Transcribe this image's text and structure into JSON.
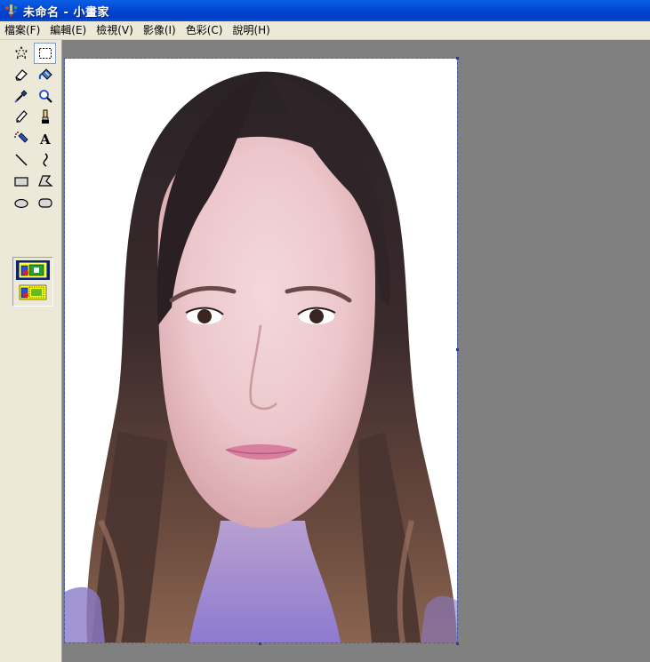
{
  "window": {
    "title": "未命名 - 小畫家"
  },
  "menu": [
    {
      "label": "檔案(F)"
    },
    {
      "label": "編輯(E)"
    },
    {
      "label": "檢視(V)"
    },
    {
      "label": "影像(I)"
    },
    {
      "label": "色彩(C)"
    },
    {
      "label": "說明(H)"
    }
  ],
  "tools": [
    {
      "name": "free-form-select",
      "icon": "free-form-select-icon"
    },
    {
      "name": "rectangle-select",
      "icon": "rectangle-select-icon",
      "selected": true
    },
    {
      "name": "eraser",
      "icon": "eraser-icon"
    },
    {
      "name": "fill-with-color",
      "icon": "paint-bucket-icon"
    },
    {
      "name": "pick-color",
      "icon": "eyedropper-icon"
    },
    {
      "name": "magnifier",
      "icon": "magnifier-icon"
    },
    {
      "name": "pencil",
      "icon": "pencil-icon"
    },
    {
      "name": "brush",
      "icon": "brush-icon"
    },
    {
      "name": "airbrush",
      "icon": "airbrush-icon"
    },
    {
      "name": "text",
      "icon": "text-icon",
      "glyph": "A"
    },
    {
      "name": "line",
      "icon": "line-icon"
    },
    {
      "name": "curve",
      "icon": "curve-icon"
    },
    {
      "name": "rectangle",
      "icon": "rectangle-icon"
    },
    {
      "name": "polygon",
      "icon": "polygon-icon"
    },
    {
      "name": "ellipse",
      "icon": "ellipse-icon"
    },
    {
      "name": "rounded-rectangle",
      "icon": "rounded-rectangle-icon"
    }
  ],
  "tool_options": [
    {
      "name": "opaque-selection",
      "icon": "opaque-selection-icon",
      "selected": true
    },
    {
      "name": "transparent-selection",
      "icon": "transparent-selection-icon"
    }
  ],
  "canvas": {
    "content": "portrait-photo"
  },
  "colors": {
    "titlebar": "#0054e3",
    "menubar": "#ece9d8",
    "workspace": "#808080",
    "selection_border": "#3a5fcd"
  }
}
